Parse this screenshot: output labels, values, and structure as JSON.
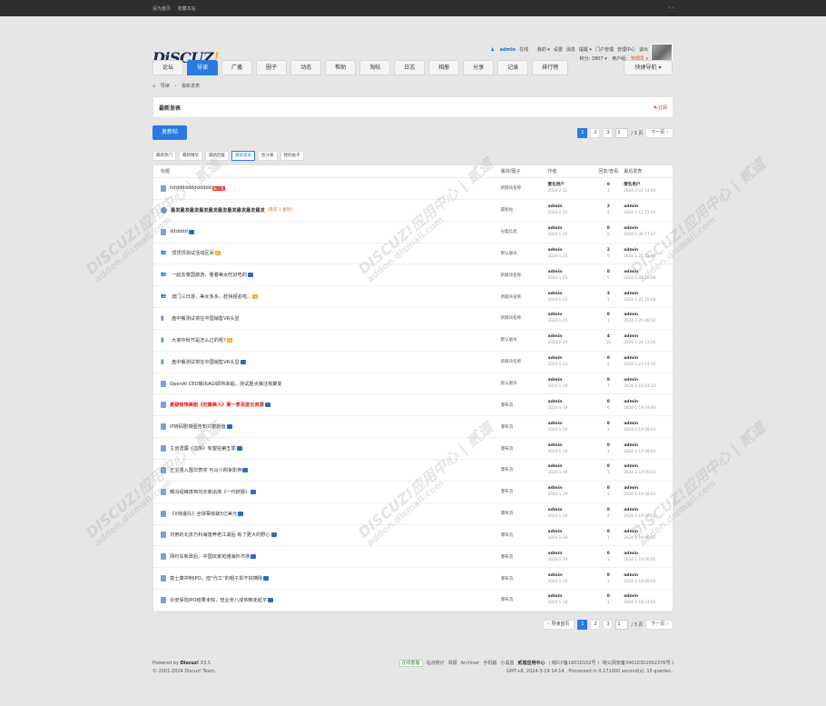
{
  "topbar": {
    "set_home": "设为首页",
    "bookmark": "收藏本站",
    "toggle": "‹ ›"
  },
  "logo": {
    "text": "DiSCUZ",
    "mark": "!"
  },
  "user": {
    "name": "admin",
    "status": "在线",
    "links": [
      "我的 ▾",
      "设置",
      "消息",
      "提醒 ▾",
      "门户管理",
      "管理中心",
      "退出"
    ],
    "points": "积分: 3807 ▾",
    "group_label": "用户组:",
    "group": "管理员 ▾"
  },
  "nav": {
    "tabs": [
      "论坛",
      "导读",
      "广播",
      "圈子",
      "动态",
      "帮助",
      "淘帖",
      "日志",
      "相册",
      "分享",
      "记录",
      "排行榜"
    ],
    "active_index": 1,
    "quick": "快捷导航 ▾"
  },
  "breadcrumb": [
    "导读",
    "›",
    "最新发表"
  ],
  "title_box": {
    "title": "最新发表",
    "rss": "订阅"
  },
  "post_button": "发新帖",
  "pager": {
    "pages": [
      "1",
      "2",
      "3"
    ],
    "current": "1",
    "jump_value": "1",
    "total": "/ 3 页",
    "next": "下一页 ›",
    "back": "‹ 导读首页"
  },
  "filters": [
    "最新热门",
    "最新精华",
    "最新回复",
    "最新发表",
    "抢沙发",
    "我的帖子"
  ],
  "filter_active": 3,
  "columns": {
    "title": "标题",
    "forum": "版块/圈子",
    "author": "作者",
    "stats": "回复/查看",
    "last": "最后发表"
  },
  "rows": [
    {
      "icon": "doc",
      "title": "hddddddddddddd",
      "badge": "new",
      "badge_text": "新人帖",
      "forum": "新版块名称",
      "author": "匿名用户",
      "adate": "2024-2-22",
      "r": "0",
      "v": "3",
      "last": "匿名用户",
      "ldate": "2024-2-22 14:00"
    },
    {
      "icon": "vote",
      "title": "最发最发最发最发最发最发最发最发最发最发",
      "bold": true,
      "reply": "[悬赏 1 金钱]",
      "forum": "最新帖",
      "author": "admin",
      "adate": "2024-2-12",
      "r": "2",
      "v": "4",
      "last": "admin",
      "ldate": "2024-2-12 15:54"
    },
    {
      "icon": "doc",
      "title": "dddddd",
      "badge": "img",
      "forum": "分类信息",
      "author": "admin",
      "adate": "2024-1-30",
      "r": "0",
      "v": "6",
      "last": "admin",
      "ldate": "2024-1-30 17:07"
    },
    {
      "icon": "group",
      "title": "顶顶顶测试活动区间",
      "badge": "hot",
      "badge_text": "火",
      "forum": "默认版块",
      "author": "admin",
      "adate": "2024-1-25",
      "r": "2",
      "v": "9",
      "last": "admin",
      "ldate": "2024-1-25 15:48"
    },
    {
      "icon": "group",
      "title": "一起去泰国旅游，看看美女吃好吃的",
      "badge": "img",
      "forum": "新版块名称",
      "author": "admin",
      "adate": "2024-1-25",
      "r": "0",
      "v": "5",
      "last": "admin",
      "ldate": "2024-1-25 10:09"
    },
    {
      "icon": "group",
      "title": "澳门三日游，美女多多，赶快报名啦...",
      "badge": "hot",
      "badge_text": "火",
      "forum": "新版块名称",
      "author": "admin",
      "adate": "2024-1-25",
      "r": "3",
      "v": "5",
      "last": "admin",
      "ldate": "2024-1-25 10:08"
    },
    {
      "icon": "bar",
      "title": "盘中餐测试将在中国销售VR头显",
      "forum": "新版块名称",
      "author": "admin",
      "adate": "2024-1-25",
      "r": "0",
      "v": "1",
      "last": "admin",
      "ldate": "2024-1-25 09:52"
    },
    {
      "icon": "bar",
      "title": "大家中秋节是怎么过的呢?",
      "badge": "hot",
      "badge_text": "火",
      "forum": "默认版块",
      "author": "admin",
      "adate": "2024-1-24",
      "r": "4",
      "v": "10",
      "last": "admin",
      "ldate": "2024-1-24 13:36"
    },
    {
      "icon": "bar",
      "title": "盘中餐测试将在中国销售VR头显",
      "badge": "img",
      "forum": "新版块名称",
      "author": "admin",
      "adate": "2024-1-23",
      "r": "0",
      "v": "5",
      "last": "admin",
      "ldate": "2024-1-23 14:34"
    },
    {
      "icon": "doc",
      "title": "OpenAI CEO曝出AGI即将来临，测试重点弹注核聚变",
      "forum": "默认版块",
      "author": "admin",
      "adate": "2024-1-19",
      "r": "0",
      "v": "7",
      "last": "admin",
      "ldate": "2024-1-19 14:13"
    },
    {
      "icon": "doc",
      "title": "悬疑惊悚美剧《犯爆美人》第一季百度云资源",
      "red": true,
      "badge": "img",
      "forum": "瀑布流",
      "author": "admin",
      "adate": "2024-1-19",
      "r": "0",
      "v": "6",
      "last": "admin",
      "ldate": "2024-1-19 19:40"
    },
    {
      "icon": "doc",
      "title": "IP转码剧授图告知只泰颜值",
      "badge": "img",
      "forum": "瀑布流",
      "author": "admin",
      "adate": "2024-1-19",
      "r": "0",
      "v": "1",
      "last": "admin",
      "ldate": "2024-1-19 00:04"
    },
    {
      "icon": "doc",
      "title": "主创透露《血族》有望拍第五季",
      "badge": "img",
      "forum": "瀑布流",
      "author": "admin",
      "adate": "2024-1-19",
      "r": "0",
      "v": "1",
      "last": "admin",
      "ldate": "2024-1-19 00:04"
    },
    {
      "icon": "doc",
      "title": "王宝强入围华表奖 与马小刚争影帝",
      "badge": "img",
      "forum": "瀑布流",
      "author": "admin",
      "adate": "2024-1-19",
      "r": "0",
      "v": "1",
      "last": "admin",
      "ldate": "2024-1-19 00:03"
    },
    {
      "icon": "doc",
      "title": "曝冯绍峰搭档刘亦菲出演《一代妖姬》",
      "badge": "img",
      "forum": "瀑布流",
      "author": "admin",
      "adate": "2024-1-19",
      "r": "0",
      "v": "1",
      "last": "admin",
      "ldate": "2024-1-19 00:03"
    },
    {
      "icon": "doc",
      "title": "《X特遣队》全球票房破5亿美元",
      "badge": "img",
      "forum": "瀑布流",
      "author": "admin",
      "adate": "2024-1-19",
      "r": "0",
      "v": "2",
      "last": "admin",
      "ldate": "2024-1-19 00:02"
    },
    {
      "icon": "doc",
      "title": "刘用的北京万科海落养老江湖后 有了更大的野心",
      "badge": "img",
      "forum": "瀑布流",
      "author": "admin",
      "adate": "2024-1-19",
      "r": "0",
      "v": "1",
      "last": "admin",
      "ldate": "2024-1-19 00:02"
    },
    {
      "icon": "doc",
      "title": "网约车新政后：中国玩家抢滩海外市场",
      "badge": "img",
      "forum": "瀑布流",
      "author": "admin",
      "adate": "2024-1-19",
      "r": "0",
      "v": "1",
      "last": "admin",
      "ldate": "2024-1-19 00:01"
    },
    {
      "icon": "doc",
      "title": "富士康冲刺IPO，但“代工”的帽子却不好摘除",
      "badge": "img",
      "forum": "瀑布流",
      "author": "admin",
      "adate": "2024-1-19",
      "r": "0",
      "v": "1",
      "last": "admin",
      "ldate": "2024-1-19 00:00"
    },
    {
      "icon": "doc",
      "title": "众安保险IPO结果未知，但业务八成依赖走起平",
      "badge": "img",
      "forum": "瀑布流",
      "author": "admin",
      "adate": "2024-1-18",
      "r": "0",
      "v": "1",
      "last": "admin",
      "ldate": "2024-1-18 23:59"
    }
  ],
  "footer": {
    "powered": "Powered by",
    "brand": "Discuz!",
    "version": "X3.5",
    "copyright": "© 2001-2024 Discuz! Team.",
    "online": "在线客服",
    "links": [
      "站点统计",
      "举报",
      "Archiver",
      "手机版",
      "小黑屋"
    ],
    "icp_name": "贰道应用中心",
    "icp": "( 皖ICP备16010102号 )",
    "police": "皖公网安备34010302002376号 )",
    "time": "GMT+8, 2024-3-19 14:14 , Processed in 0.171000 second(s), 15 queries ."
  },
  "watermark": {
    "main": "DISCUZ!应用中心 | 贰道",
    "sub": "addon.dismall.com"
  },
  "colors": {
    "accent": "#2a7ae2",
    "topbar": "#2e2e2e",
    "background": "#e6e6e6",
    "hot": "#f7a61c",
    "new": "#e33333"
  }
}
